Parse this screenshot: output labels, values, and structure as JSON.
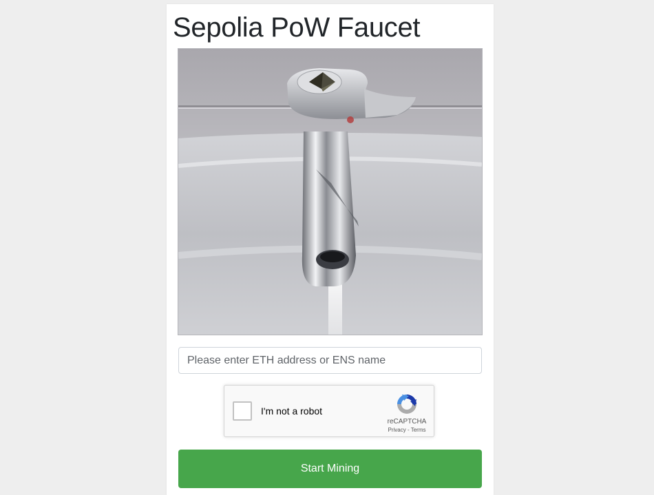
{
  "page": {
    "title": "Sepolia PoW Faucet"
  },
  "image": {
    "alt": "Faucet tap with Ethereum logo"
  },
  "address_input": {
    "placeholder": "Please enter ETH address or ENS name",
    "value": ""
  },
  "recaptcha": {
    "label": "I'm not a robot",
    "brand": "reCAPTCHA",
    "privacy": "Privacy",
    "separator": " - ",
    "terms": "Terms",
    "icon": "recaptcha-logo-icon"
  },
  "start_button": {
    "label": "Start Mining"
  },
  "colors": {
    "background": "#eeeeee",
    "panel": "#ffffff",
    "button": "#47a64b",
    "button_text": "#ffffff",
    "recaptcha_blue": "#1c3aa9",
    "recaptcha_light_blue": "#4a90e2",
    "recaptcha_gray": "#ababab"
  }
}
